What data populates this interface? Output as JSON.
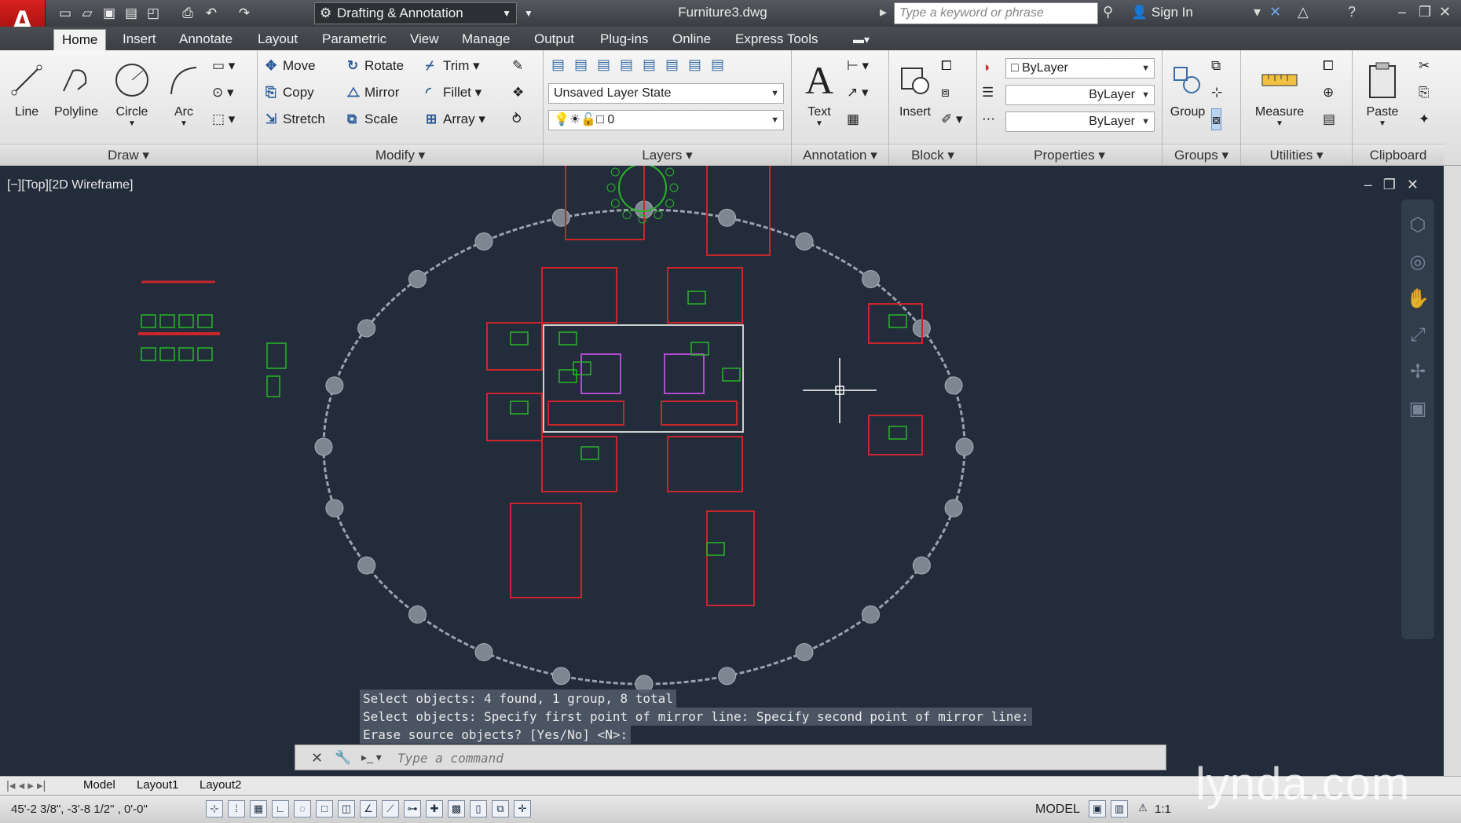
{
  "window": {
    "title": "Furniture3.dwg",
    "workspace": "Drafting & Annotation",
    "search_placeholder": "Type a keyword or phrase",
    "sign_in": "Sign In"
  },
  "tabs": [
    "Home",
    "Insert",
    "Annotate",
    "Layout",
    "Parametric",
    "View",
    "Manage",
    "Output",
    "Plug-ins",
    "Online",
    "Express Tools"
  ],
  "ribbon": {
    "draw": {
      "label": "Draw",
      "line": "Line",
      "polyline": "Polyline",
      "circle": "Circle",
      "arc": "Arc"
    },
    "modify": {
      "label": "Modify",
      "move": "Move",
      "rotate": "Rotate",
      "trim": "Trim",
      "copy": "Copy",
      "mirror": "Mirror",
      "fillet": "Fillet",
      "stretch": "Stretch",
      "scale": "Scale",
      "array": "Array"
    },
    "layers": {
      "label": "Layers",
      "layer_state": "Unsaved Layer State",
      "current_layer": "0"
    },
    "annotation": {
      "label": "Annotation",
      "text": "Text"
    },
    "block": {
      "label": "Block",
      "insert": "Insert"
    },
    "properties": {
      "label": "Properties",
      "color": "ByLayer",
      "lineweight": "ByLayer",
      "linetype": "ByLayer"
    },
    "groups": {
      "label": "Groups",
      "group": "Group"
    },
    "utilities": {
      "label": "Utilities",
      "measure": "Measure"
    },
    "clipboard": {
      "label": "Clipboard",
      "paste": "Paste"
    }
  },
  "viewport": {
    "label": "[−][Top][2D Wireframe]"
  },
  "command_history": [
    "Select objects: 4 found, 1 group, 8 total",
    "Select objects:  Specify first point of mirror line: Specify second point of mirror line:",
    "Erase source objects? [Yes/No] <N>:"
  ],
  "command_placeholder": "Type a command",
  "layout_tabs": [
    "Model",
    "Layout1",
    "Layout2"
  ],
  "status": {
    "coords": "45'-2 3/8\",  -3'-8 1/2\" , 0'-0\"",
    "model": "MODEL",
    "scale": "1:1"
  },
  "watermark": "lynda.com",
  "colors": {
    "canvas": "#222c3a",
    "ring": "#9aa3ad",
    "wall": "#c8262a",
    "furniture": "#28b528",
    "accent": "#d8201d"
  }
}
